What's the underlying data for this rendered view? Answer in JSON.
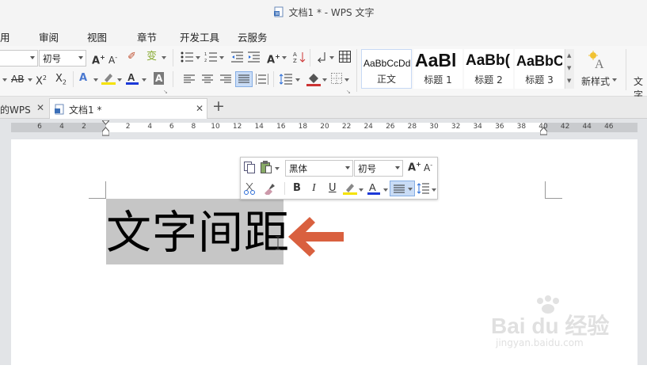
{
  "window": {
    "title": "文档1 * - WPS 文字"
  },
  "menu": {
    "items": [
      "用",
      "审阅",
      "视图",
      "章节",
      "开发工具",
      "云服务"
    ]
  },
  "ribbon": {
    "font_size": "初号",
    "grow_font": "A",
    "shrink_font": "A",
    "strike": "AB",
    "superscript": "X",
    "subscript": "X",
    "wen": "变",
    "styles": [
      {
        "preview": "AaBbCcDd",
        "label": "正文"
      },
      {
        "preview": "AaBl",
        "label": "标题 1"
      },
      {
        "preview": "AaBb(",
        "label": "标题 2"
      },
      {
        "preview": "AaBbC",
        "label": "标题 3"
      }
    ],
    "new_style": "新样式",
    "text_tool": "文字"
  },
  "tabs": [
    {
      "label": "的WPS"
    },
    {
      "label": "文档1 *"
    }
  ],
  "ruler": {
    "left_numbers": [
      "6",
      "4",
      "2"
    ],
    "numbers": [
      "2",
      "4",
      "6",
      "8",
      "10",
      "12",
      "14",
      "16",
      "18",
      "20",
      "22",
      "24",
      "26",
      "28",
      "30",
      "32",
      "34",
      "36",
      "38",
      "40",
      "42",
      "44",
      "46"
    ]
  },
  "document": {
    "text": "文字间距"
  },
  "float_toolbar": {
    "font_name": "黑体",
    "font_size": "初号",
    "bold": "B",
    "italic": "I",
    "underline": "U",
    "grow": "A",
    "shrink": "A"
  },
  "watermark": {
    "brand": "Bai du 经验",
    "url": "jingyan.baidu.com"
  },
  "colors": {
    "accent_blue": "#2b6dd8",
    "arrow": "#d9603f",
    "font_color": "#1c39d8",
    "highlight": "#f5e200",
    "selection": "#c6c6c6"
  }
}
